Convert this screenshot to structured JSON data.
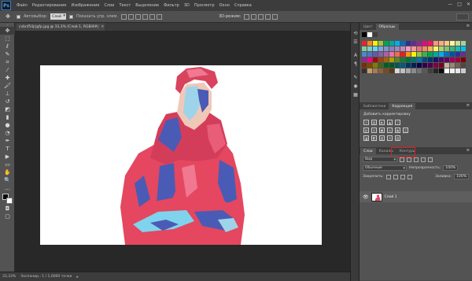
{
  "menubar": {
    "logo": "Ps",
    "items": [
      "Файл",
      "Редактирование",
      "Изображение",
      "Слои",
      "Текст",
      "Выделение",
      "Фильтр",
      "3D",
      "Просмотр",
      "Окно",
      "Справка"
    ],
    "controls": {
      "minimize": "—",
      "maximize": "□",
      "close": "✕"
    }
  },
  "options": {
    "tool_icon": "move-tool",
    "autoselect_label": "Автовыбор:",
    "autoselect_value": "Слой",
    "show_controls_label": "Показать упр. элем.",
    "mode_3d_label": "3D-режим:"
  },
  "document": {
    "tab_title": "cvbnf54jrjgfp.jpg @ 33,3% (Слой 1, RGB/8#)",
    "tab_close": "✕"
  },
  "toolbar": {
    "grip": "»",
    "tools": [
      {
        "name": "move-tool",
        "glyph": "✥",
        "selected": true
      },
      {
        "name": "marquee-tool",
        "glyph": "⬚"
      },
      {
        "name": "lasso-tool",
        "glyph": "ℓ"
      },
      {
        "name": "quick-select-tool",
        "glyph": "✎"
      },
      {
        "name": "crop-tool",
        "glyph": "⌗"
      },
      {
        "name": "eyedropper-tool",
        "glyph": "⁄"
      },
      {
        "name": "healing-brush-tool",
        "glyph": "✚"
      },
      {
        "name": "brush-tool",
        "glyph": "🖌"
      },
      {
        "name": "clone-stamp-tool",
        "glyph": "⊥"
      },
      {
        "name": "history-brush-tool",
        "glyph": "↺"
      },
      {
        "name": "eraser-tool",
        "glyph": "◩"
      },
      {
        "name": "gradient-tool",
        "glyph": "▮"
      },
      {
        "name": "blur-tool",
        "glyph": "●"
      },
      {
        "name": "dodge-tool",
        "glyph": "◔"
      },
      {
        "name": "pen-tool",
        "glyph": "✒"
      },
      {
        "name": "type-tool",
        "glyph": "T"
      },
      {
        "name": "path-select-tool",
        "glyph": "▶"
      },
      {
        "name": "shape-tool",
        "glyph": "▭"
      },
      {
        "name": "hand-tool",
        "glyph": "✋"
      },
      {
        "name": "zoom-tool",
        "glyph": "🔍"
      },
      {
        "name": "more-tools",
        "glyph": "…"
      }
    ],
    "quickmask": "◘",
    "screenmode": "▢"
  },
  "status": {
    "zoom": "33,33%",
    "doc_info": "Экспонир.: 1 / 1,0000 точки",
    "arrow": "▸"
  },
  "dock": {
    "icons": [
      "history-icon",
      "properties-icon",
      "character-icon",
      "paragraph-icon",
      "brush-icon",
      "clone-icon",
      "layers-comp-icon"
    ]
  },
  "panels": {
    "swatches_tabs": [
      "Цвет",
      "Образцы"
    ],
    "swatches_active": 1,
    "menu_icon": "≡",
    "swatch_head": [
      "#000000",
      "#ffffff",
      "#3f3f3f"
    ],
    "swatch_colors": [
      "#e8232a",
      "#f5862a",
      "#fff200",
      "#9cca3c",
      "#00a651",
      "#00a99d",
      "#00aeef",
      "#0072bc",
      "#2e3192",
      "#662d91",
      "#92278f",
      "#ec008c",
      "#ed145b",
      "#f7977a",
      "#f9ad81",
      "#fdc68a",
      "#fff79a",
      "#c4df9b",
      "#a3d39c",
      "#82ca9d",
      "#7bcdc8",
      "#6dcff6",
      "#7da7d9",
      "#8393ca",
      "#8781bd",
      "#a186be",
      "#bd8cbf",
      "#f49ac2",
      "#f6989d",
      "#f26d7d",
      "#f68e56",
      "#fbaf5d",
      "#fff467",
      "#acd372",
      "#7cc576",
      "#3bb878",
      "#1abbb4",
      "#00bff3",
      "#438ccb",
      "#5574b9",
      "#605ca8",
      "#855fa8",
      "#a763a8",
      "#f06eaa",
      "#f26c4f",
      "#ed1c24",
      "#f7941d",
      "#fff200",
      "#8dc63f",
      "#39b54a",
      "#00a651",
      "#00a99d",
      "#00aeef",
      "#0072bc",
      "#0054a6",
      "#2e3192",
      "#662d91",
      "#92278f",
      "#ec008c",
      "#9e0b0f",
      "#a0410d",
      "#a3620a",
      "#aba000",
      "#598527",
      "#197b30",
      "#007236",
      "#00746b",
      "#0076a3",
      "#004a80",
      "#003471",
      "#1b1464",
      "#440e62",
      "#630460",
      "#9e005d",
      "#9e0039",
      "#790000",
      "#7b2e00",
      "#7d4900",
      "#827b00",
      "#406618",
      "#005e20",
      "#005826",
      "#005952",
      "#005b7f",
      "#003663",
      "#002157",
      "#0d004c",
      "#32004b",
      "#4b0049",
      "#7b0046",
      "#7a0026",
      "#c7b299",
      "#998675",
      "#736357",
      "#534741",
      "#37302d",
      "#c69c6d",
      "#a67c52",
      "#8c6239",
      "#754c24",
      "#603913",
      "#d9d9d9",
      "#bfbfbf",
      "#a6a6a6",
      "#8c8c8c",
      "#737373",
      "#595959",
      "#404040",
      "#262626",
      "#0d0d0d",
      "#ffffff",
      "#f2f2f2",
      "#e6e6e6",
      "#cccccc"
    ],
    "adj_tabs": [
      "Библиотеки",
      "Коррекция"
    ],
    "adj_active": 1,
    "adj_title": "Добавить корректировку",
    "adj_row1": [
      "☼",
      "▥",
      "◐",
      "▲",
      "▽"
    ],
    "adj_row2": [
      "▤",
      "⚖",
      "▣",
      "◎",
      "▦",
      "◫"
    ],
    "adj_row3": [
      "◪",
      "◩",
      "▨",
      "⊡",
      "▧"
    ],
    "layers_tabs": [
      "Слои",
      "Каналы",
      "Контуры"
    ],
    "layers_active": 0,
    "kind_label": "Вид",
    "blend_mode": "Обычные",
    "opacity_label": "Непрозрачность:",
    "opacity_value": "100%",
    "lock_label": "Закрепить:",
    "fill_label": "Заливка:",
    "fill_value": "100%",
    "layer_name": "Слой 1",
    "eye_glyph": "👁",
    "footer_icons": [
      "⛓",
      "fx",
      "◑",
      "◐",
      "▭",
      "▢",
      "🗑"
    ]
  }
}
